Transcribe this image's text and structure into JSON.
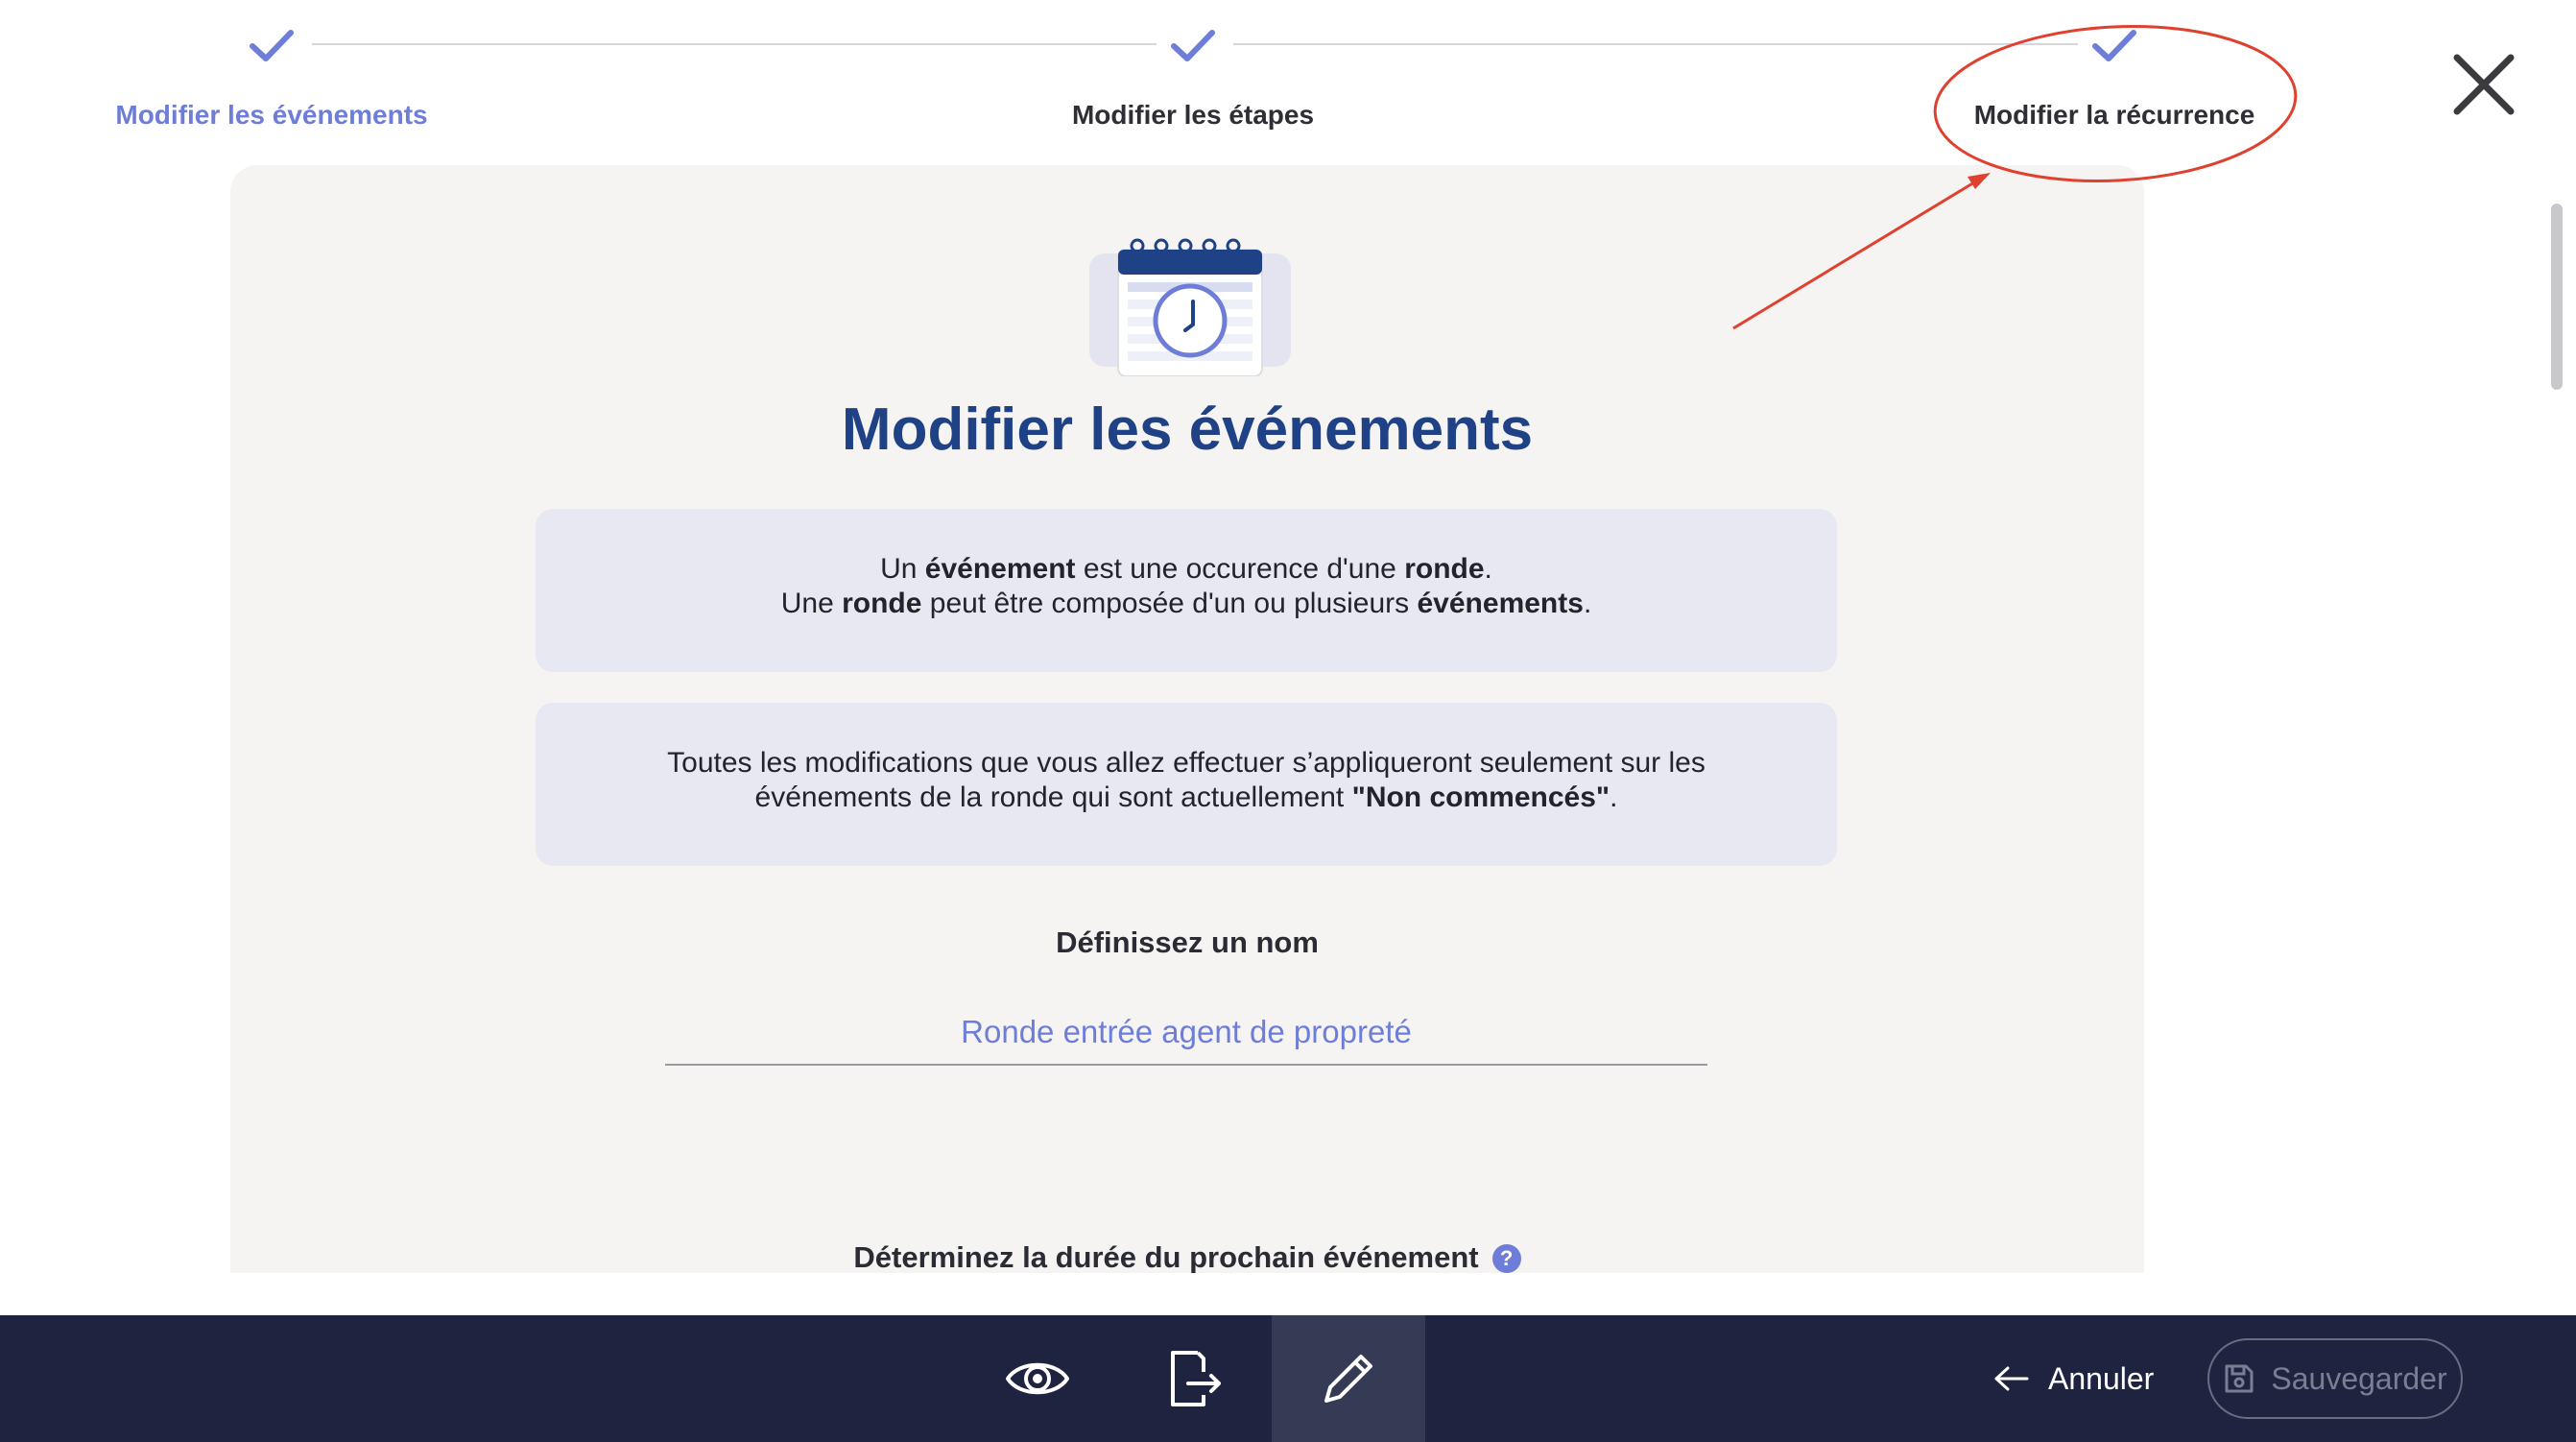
{
  "stepper": {
    "steps": [
      {
        "label": "Modifier les événements",
        "state": "done"
      },
      {
        "label": "Modifier les étapes",
        "state": "done"
      },
      {
        "label": "Modifier la récurrence",
        "state": "done"
      }
    ],
    "check_color": "#6e7ed8",
    "close_icon": "close-icon"
  },
  "main": {
    "illustration": "calendar-clock-icon",
    "title": "Modifier les événements",
    "info1": {
      "line1": {
        "a": "Un ",
        "b": "événement",
        "c": " est une occurence d'une ",
        "d": "ronde",
        "e": "."
      },
      "line2": {
        "a": "Une ",
        "b": "ronde",
        "c": " peut être composée d'un ou plusieurs ",
        "d": "événements",
        "e": "."
      }
    },
    "info2": {
      "line1": "Toutes les modifications que vous allez effectuer s’appliqueront seulement sur les",
      "line2": {
        "a": "événements de la ronde qui sont actuellement ",
        "b": "\"Non commencés\"",
        "c": "."
      }
    },
    "name_label": "Définissez un nom",
    "name_value": "Ronde entrée agent de propreté",
    "duration_label": "Déterminez la durée du prochain événement",
    "help_glyph": "?"
  },
  "toolbar": {
    "tools": [
      {
        "icon": "eye-icon",
        "active": false
      },
      {
        "icon": "export-document-icon",
        "active": false
      },
      {
        "icon": "pencil-icon",
        "active": true
      }
    ],
    "cancel_label": "Annuler",
    "save_label": "Sauvegarder",
    "background": "#1e2340"
  },
  "annotation": {
    "color": "#e0412f"
  }
}
